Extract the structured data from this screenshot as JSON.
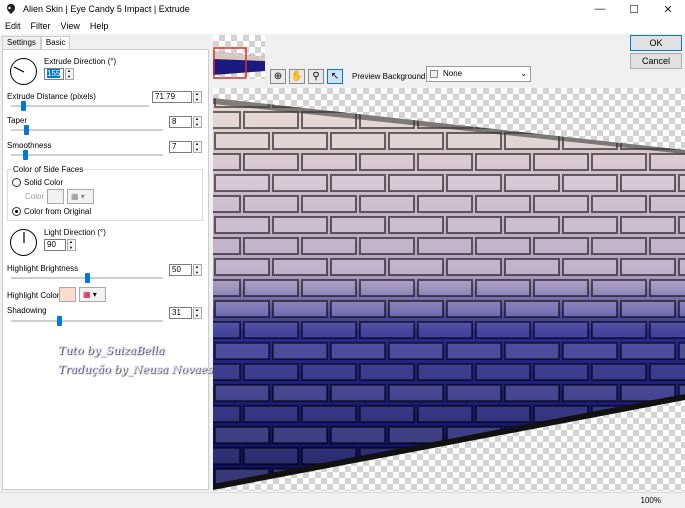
{
  "window": {
    "title": "Alien Skin | Eye Candy 5 Impact | Extrude",
    "minimize": "—",
    "maximize": "☐",
    "close": "✕"
  },
  "menu": {
    "items": [
      "Edit",
      "Filter",
      "View",
      "Help"
    ]
  },
  "tabs": [
    "Settings",
    "Basic"
  ],
  "basic": {
    "extrude_direction": {
      "label": "Extrude Direction (°)",
      "value": "155"
    },
    "extrude_distance": {
      "label": "Extrude Distance (pixels)",
      "value": "71.79",
      "level": 0.1
    },
    "taper": {
      "label": "Taper",
      "value": "8",
      "level": 0.08
    },
    "smoothness": {
      "label": "Smoothness",
      "value": "7",
      "level": 0.07
    },
    "side_faces": {
      "group_label": "Color of Side Faces",
      "solid_color": "Solid Color",
      "color_label": "Color",
      "from_original": "Color from Original",
      "selected": "from_original"
    },
    "light_direction": {
      "label": "Light Direction (°)",
      "value": "90"
    },
    "highlight_brightness": {
      "label": "Highlight Brightness",
      "value": "50",
      "level": 0.5
    },
    "highlight_color": {
      "label": "Highlight Color",
      "color": "#f8dcd0"
    },
    "shadowing": {
      "label": "Shadowing",
      "value": "31",
      "level": 0.31
    }
  },
  "preview": {
    "background_label": "Preview Background:",
    "background_value": "None",
    "tools": [
      "zoom-preview-icon",
      "hand-icon",
      "magnifier-icon",
      "pointer-icon"
    ]
  },
  "buttons": {
    "ok": "OK",
    "cancel": "Cancel"
  },
  "watermark": {
    "line1": "Tuto by_SuizaBella",
    "line2": "Tradução by_Neusa Novaes"
  },
  "status": {
    "zoom": "100%"
  },
  "colors": {
    "accent": "#0078d7",
    "wall_top": "#e8d4cc",
    "wall_bottom": "#101070"
  }
}
